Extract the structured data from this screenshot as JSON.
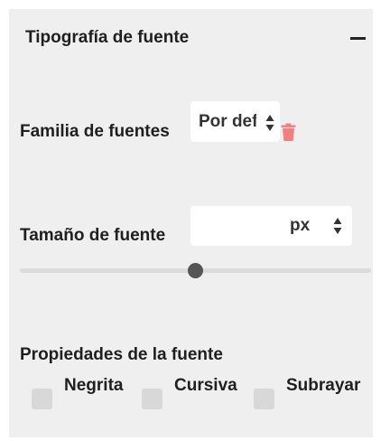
{
  "panel": {
    "title": "Tipografía de fuente"
  },
  "font_family": {
    "label": "Familia de fuentes",
    "selected_value": "Por defecto"
  },
  "font_size": {
    "label": "Tamaño de fuente",
    "value": "",
    "unit": "px",
    "slider_position": 0.5
  },
  "font_properties": {
    "label": "Propiedades de la fuente",
    "options": [
      {
        "label": "Negrita",
        "checked": false
      },
      {
        "label": "Cursiva",
        "checked": false
      },
      {
        "label": "Subrayar",
        "checked": false
      }
    ]
  },
  "colors": {
    "panel_bg": "#efefef",
    "trash_icon": "#f08080",
    "slider_thumb": "#555555",
    "checkbox": "#d8d8d8"
  },
  "icons": {
    "collapse": "minus-icon",
    "delete": "trash-icon",
    "select_arrows": "up-down-arrows-icon"
  }
}
